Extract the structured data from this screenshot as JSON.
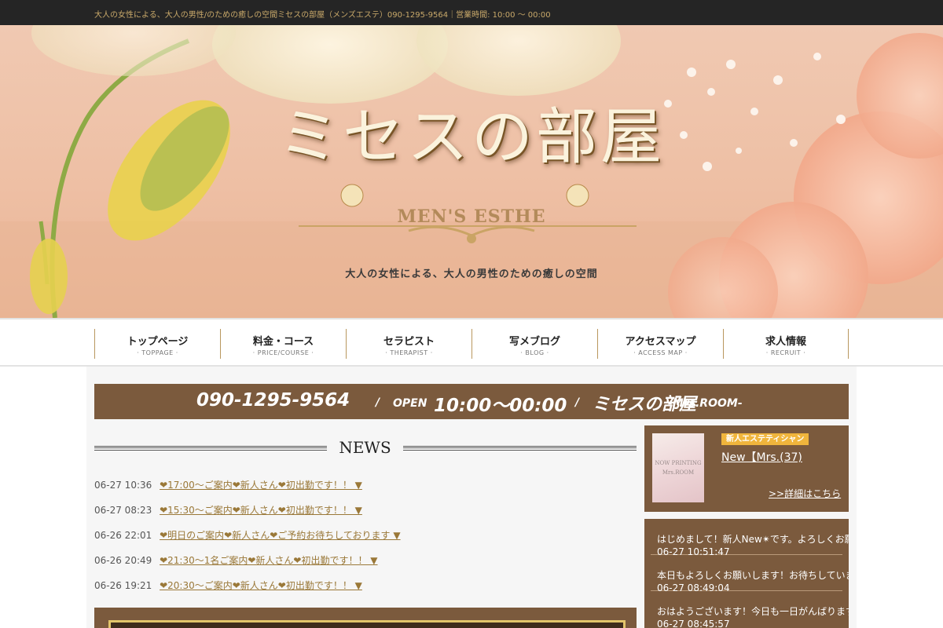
{
  "topbar": {
    "text": "大人の女性による、大人の男性/のための癒しの空間ミセスの部屋（メンズエステ）090-1295-9564｜営業時間: 10:00 ～ 00:00"
  },
  "hero": {
    "title": "ミセスの部屋",
    "subtitle": "MEN'S ESTHE",
    "tagline": "大人の女性による、大人の男性のための癒しの空間"
  },
  "nav": {
    "items": [
      {
        "label": "トップページ",
        "sub": "· TOPPAGE ·"
      },
      {
        "label": "料金・コース",
        "sub": "· PRICE/COURSE ·"
      },
      {
        "label": "セラピスト",
        "sub": "· THERAPIST ·"
      },
      {
        "label": "写メブログ",
        "sub": "· BLOG ·"
      },
      {
        "label": "アクセスマップ",
        "sub": "· ACCESS MAP ·"
      },
      {
        "label": "求人情報",
        "sub": "· RECRUIT ·"
      }
    ]
  },
  "band": {
    "phone": "090-1295-9564",
    "slash": "/",
    "open_label": "OPEN",
    "hours": "10:00～00:00",
    "shop_name": "ミセスの部屋",
    "shop_name_en": "-Mrs.ROOM-"
  },
  "news": {
    "heading": "NEWS",
    "items": [
      {
        "date": "06-27 10:36",
        "text": "❤17:00～ご案内❤新人さん❤初出勤です！！ ▼"
      },
      {
        "date": "06-27 08:23",
        "text": "❤15:30～ご案内❤新人さん❤初出勤です！！ ▼"
      },
      {
        "date": "06-26 22:01",
        "text": "❤明日のご案内❤新人さん❤ご予約お待ちしております ▼"
      },
      {
        "date": "06-26 20:49",
        "text": "❤21:30～1名ご案内❤新人さん❤初出勤です！！ ▼"
      },
      {
        "date": "06-26 19:21",
        "text": "❤20:30～ご案内❤新人さん❤初出勤です！！ ▼"
      }
    ]
  },
  "sidebar": {
    "newcomer": {
      "thumb_line1": "NOW PRINTING",
      "thumb_line2": "Mrs.ROOM",
      "badge": "新人エステティシャン",
      "name": "New【Mrs.(37)",
      "more": ">>詳細はこちら"
    },
    "blog": [
      {
        "title": "はじめまして！新人New✴です。よろしくお願いいたします！",
        "time": "06-27 10:51:47"
      },
      {
        "title": "本日もよろしくお願いします！お待ちしています",
        "time": "06-27 08:49:04"
      },
      {
        "title": "おはようございます！今日も一日がんばります",
        "time": "06-27 08:45:57"
      }
    ]
  },
  "colors": {
    "brown": "#7b5a3d",
    "gold": "#c9a96a",
    "badge": "#f0b53c",
    "link": "#9a7838"
  }
}
